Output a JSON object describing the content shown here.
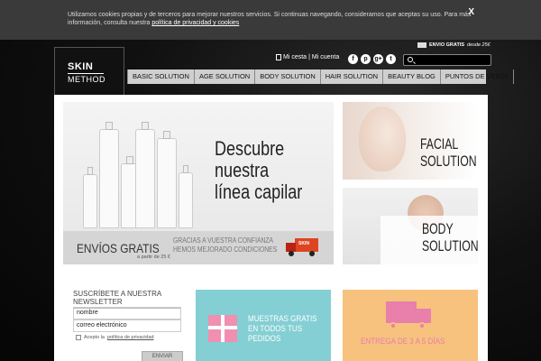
{
  "cookie": {
    "text": "Utilizamos cookies propias y de terceros para mejorar nuestros servicios. Si continuas navegando, consideramos que aceptas su uso. Para más información, consulta nuestra",
    "link": "política de privacidad y cookies",
    "close": "X"
  },
  "logo": {
    "line1": "SKIN",
    "line2": "METHOD"
  },
  "shipping": {
    "label": "ENVIO GRATIS",
    "suffix": "desde 25€"
  },
  "account": {
    "cart": "Mi cesta",
    "separator": "|",
    "account": "Mi cuenta"
  },
  "socials": [
    {
      "icon": "facebook-icon",
      "glyph": "f"
    },
    {
      "icon": "pinterest-icon",
      "glyph": "p"
    },
    {
      "icon": "googleplus-icon",
      "glyph": "g+"
    },
    {
      "icon": "twitter-icon",
      "glyph": "t"
    }
  ],
  "nav": {
    "items": [
      "BASIC SOLUTION",
      "AGE SOLUTION",
      "BODY SOLUTION",
      "HAIR SOLUTION",
      "BEAUTY BLOG",
      "PUNTOS DE VENTA"
    ]
  },
  "hero": {
    "line1": "Descubre",
    "line2": "nuestra",
    "line3": "línea capilar"
  },
  "promo_strip": {
    "big": "ENVÍOS GRATIS",
    "small": "a partir de 25 €",
    "msg1": "GRACIAS A VUESTRA CONFIANZA",
    "msg2": "HEMOS MEJORADO CONDICIONES",
    "truck_label": "SKIN"
  },
  "cards": {
    "facial": {
      "line1": "FACIAL",
      "line2": "SOLUTION"
    },
    "body": {
      "line1": "BODY",
      "line2": "SOLUTION"
    }
  },
  "newsletter": {
    "title": "SUSCRÍBETE A NUESTRA NEWSLETTER",
    "name_placeholder": "nombre",
    "email_placeholder": "correo electrónico",
    "accept": "Acepto la",
    "policy": "política de privacidad",
    "submit": "ENVIAR"
  },
  "tiles": {
    "samples": {
      "line1": "MUESTRAS GRATIS",
      "line2": "EN TODOS TUS",
      "line3": "PEDIDOS"
    },
    "delivery": {
      "text": "ENTREGA DE 3 A 5 DÍAS"
    }
  },
  "colors": {
    "cyan_tile": "#84cfd4",
    "orange_tile": "#f7c27e",
    "pink_accent": "#e97fab"
  }
}
